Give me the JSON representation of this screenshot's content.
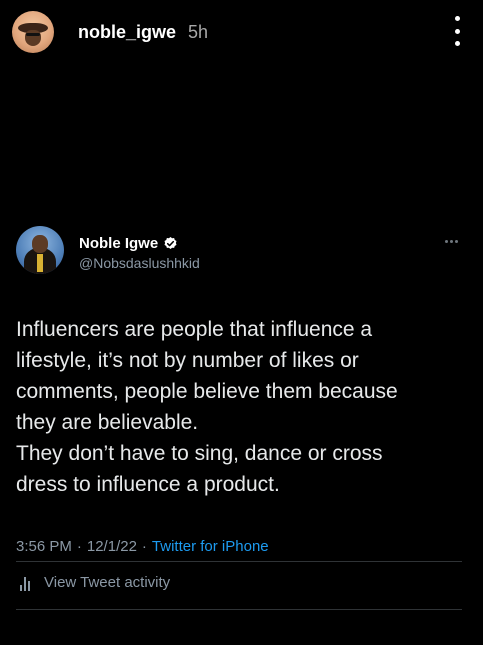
{
  "story": {
    "username": "noble_igwe",
    "time": "5h",
    "menu_icon": "vertical-ellipsis-icon"
  },
  "tweet": {
    "display_name": "Noble Igwe",
    "handle": "@Nobsdaslushhkid",
    "verified": true,
    "text_lines": [
      "Influencers are people that influence a",
      "lifestyle, it’s not by number of likes or",
      "comments, people believe them because",
      "they are believable.",
      "They don’t have to sing, dance or cross",
      "dress to influence a product."
    ],
    "time": "3:56 PM",
    "date": "12/1/22",
    "separator": "·",
    "source": "Twitter for iPhone",
    "activity_label": "View Tweet activity"
  },
  "colors": {
    "background": "#000000",
    "text": "#e7e9ea",
    "secondary": "#8b98a5",
    "link": "#1d9bf0",
    "divider": "#2f3336"
  }
}
